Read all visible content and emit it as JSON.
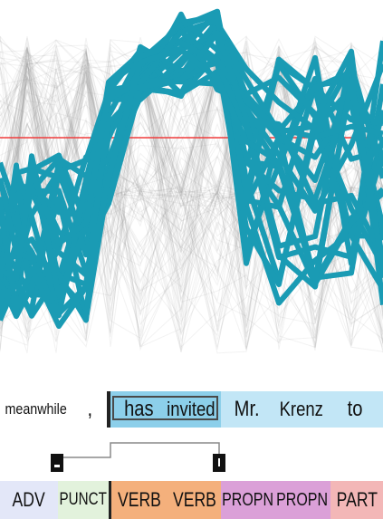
{
  "visualization": {
    "tokens": [
      {
        "text": "meanwhile",
        "bg": "#ffffff"
      },
      {
        "text": ",",
        "bg": "#ffffff"
      },
      {
        "text": "has",
        "bg": "#8ccfea",
        "selected": true
      },
      {
        "text": "invited",
        "bg": "#8ccfea",
        "selected": true
      },
      {
        "text": "Mr.",
        "bg": "#c2e6f6"
      },
      {
        "text": "Krenz",
        "bg": "#c2e6f6"
      },
      {
        "text": "to",
        "bg": "#c2e6f6"
      }
    ],
    "pos_tags": [
      {
        "text": "ADV",
        "bg": "#e3e7f8"
      },
      {
        "text": "PUNCT",
        "bg": "#e2f2dc"
      },
      {
        "text": "VERB",
        "bg": "#f4b07c"
      },
      {
        "text": "VERB",
        "bg": "#f4b07c"
      },
      {
        "text": "PROPN",
        "bg": "#dba0d8"
      },
      {
        "text": "PROPN",
        "bg": "#dba0d8"
      },
      {
        "text": "PART",
        "bg": "#f3b7b7"
      }
    ],
    "colors": {
      "highlight_lines": "#1a9bb4",
      "background_lines": "#9a9a9a",
      "reference_line": "#f03c3c",
      "selection_border": "#4a4a4a",
      "sentence_divider": "#222222"
    }
  }
}
